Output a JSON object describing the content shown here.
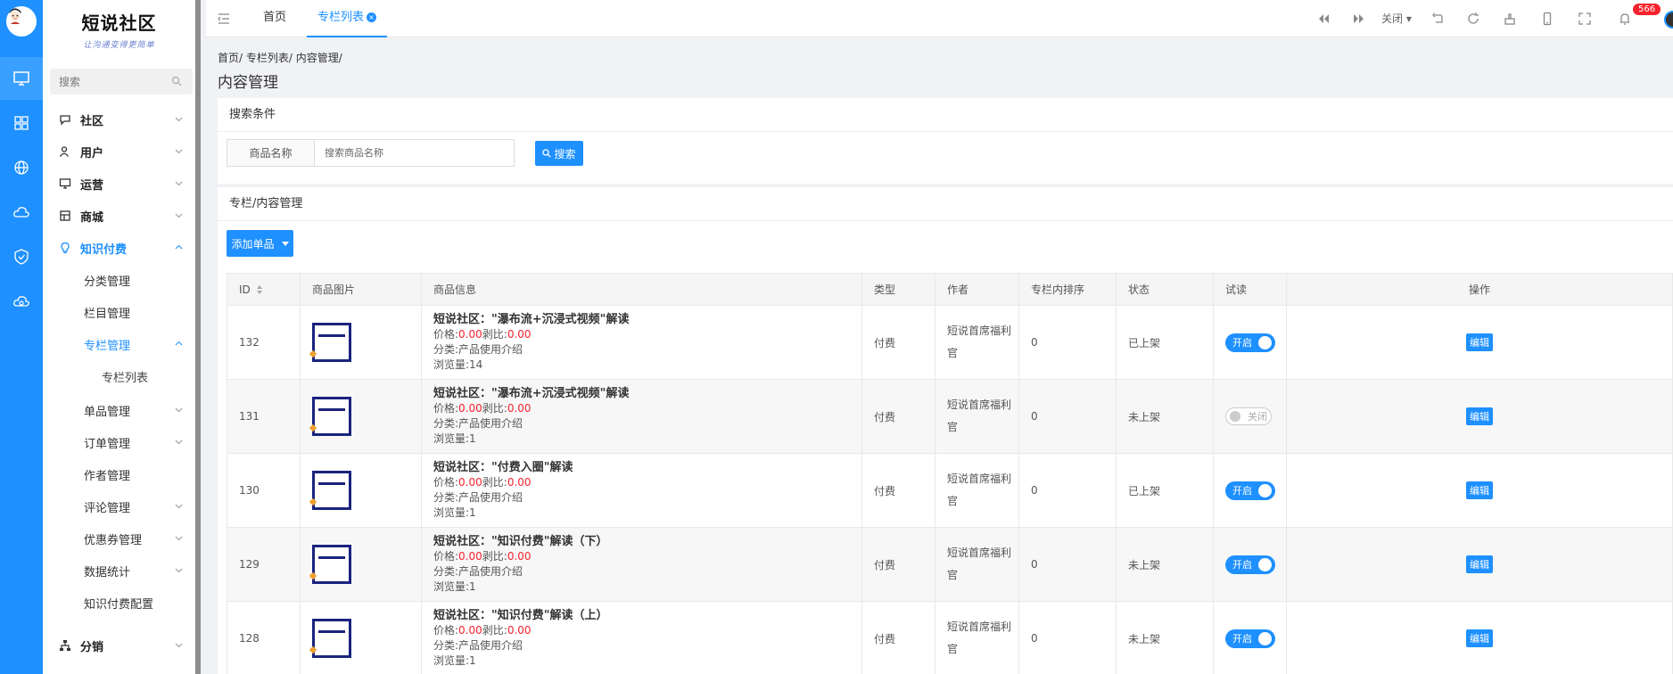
{
  "logo": {
    "title": "短说社区",
    "slogan": "让沟通变得更简单"
  },
  "sidebar": {
    "search_placeholder": "搜索",
    "nav": [
      {
        "label": "社区",
        "icon": "chat-icon"
      },
      {
        "label": "用户",
        "icon": "user-icon"
      },
      {
        "label": "运营",
        "icon": "monitor-icon"
      },
      {
        "label": "商城",
        "icon": "shop-icon"
      },
      {
        "label": "知识付费",
        "icon": "bulb-icon"
      }
    ],
    "knowledge_sub": [
      "分类管理",
      "栏目管理",
      "专栏管理"
    ],
    "column_sub": [
      "专栏列表"
    ],
    "more_sub": [
      "单品管理",
      "订单管理",
      "作者管理",
      "评论管理",
      "优惠券管理",
      "数据统计",
      "知识付费配置"
    ],
    "distribution": {
      "label": "分销",
      "icon": "org-icon"
    }
  },
  "topbar": {
    "tabs": [
      "首页",
      "专栏列表"
    ],
    "close_label": "关闭",
    "notification_count": "566"
  },
  "main": {
    "breadcrumb": "首页/ 专栏列表/ 内容管理/",
    "page_title": "内容管理",
    "search": {
      "title": "搜索条件",
      "field_label": "商品名称",
      "field_placeholder": "搜索商品名称",
      "button": "搜索"
    },
    "list": {
      "title": "专栏/内容管理",
      "add_button": "添加单品"
    }
  },
  "table": {
    "columns": [
      "ID",
      "商品图片",
      "商品信息",
      "类型",
      "作者",
      "专栏内排序",
      "状态",
      "试读",
      "操作"
    ],
    "rows": [
      {
        "id": "132",
        "title": "短说社区：\"瀑布流+沉浸式视频\"解读",
        "price_label": "价格:",
        "price": "0.00",
        "deduct_label": "剥比:",
        "deduct": "0.00",
        "category": "分类:产品使用介绍",
        "views": "浏览量:14",
        "type": "付费",
        "author": "短说首席福利官",
        "sort": "0",
        "status": "已上架",
        "trial": "开启",
        "trial_on": true,
        "op": "编辑"
      },
      {
        "id": "131",
        "title": "短说社区：\"瀑布流+沉浸式视频\"解读",
        "price_label": "价格:",
        "price": "0.00",
        "deduct_label": "剥比:",
        "deduct": "0.00",
        "category": "分类:产品使用介绍",
        "views": "浏览量:1",
        "type": "付费",
        "author": "短说首席福利官",
        "sort": "0",
        "status": "未上架",
        "trial": "关闭",
        "trial_on": false,
        "op": "编辑"
      },
      {
        "id": "130",
        "title": "短说社区：\"付费入圈\"解读",
        "price_label": "价格:",
        "price": "0.00",
        "deduct_label": "剥比:",
        "deduct": "0.00",
        "category": "分类:产品使用介绍",
        "views": "浏览量:1",
        "type": "付费",
        "author": "短说首席福利官",
        "sort": "0",
        "status": "已上架",
        "trial": "开启",
        "trial_on": true,
        "op": "编辑"
      },
      {
        "id": "129",
        "title": "短说社区：\"知识付费\"解读（下）",
        "price_label": "价格:",
        "price": "0.00",
        "deduct_label": "剥比:",
        "deduct": "0.00",
        "category": "分类:产品使用介绍",
        "views": "浏览量:1",
        "type": "付费",
        "author": "短说首席福利官",
        "sort": "0",
        "status": "未上架",
        "trial": "开启",
        "trial_on": true,
        "op": "编辑"
      },
      {
        "id": "128",
        "title": "短说社区：\"知识付费\"解读（上）",
        "price_label": "价格:",
        "price": "0.00",
        "deduct_label": "剥比:",
        "deduct": "0.00",
        "category": "分类:产品使用介绍",
        "views": "浏览量:1",
        "type": "付费",
        "author": "短说首席福利官",
        "sort": "0",
        "status": "未上架",
        "trial": "开启",
        "trial_on": true,
        "op": "编辑"
      }
    ]
  },
  "colors": {
    "primary": "#1e90ff",
    "price": "#f5222d",
    "rail": "#1e90ff"
  }
}
